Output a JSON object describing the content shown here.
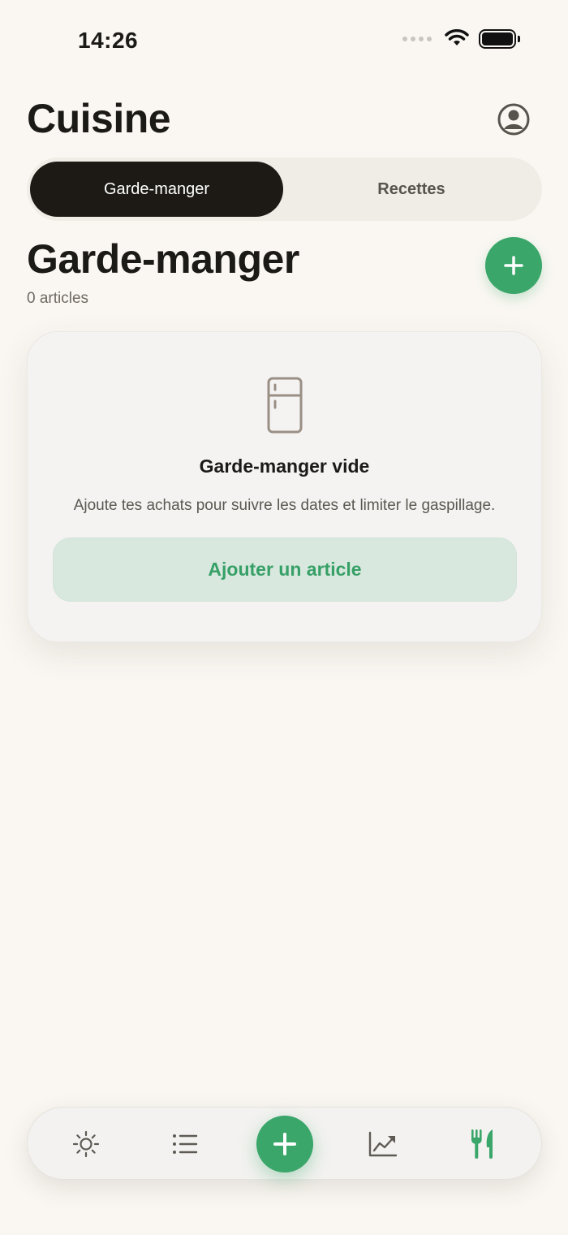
{
  "status_bar": {
    "time": "14:26"
  },
  "header": {
    "title": "Cuisine",
    "profile_icon": "person-circle-icon"
  },
  "segmented": {
    "tabs": [
      {
        "label": "Garde-manger",
        "active": true
      },
      {
        "label": "Recettes",
        "active": false
      }
    ]
  },
  "section": {
    "title": "Garde-manger",
    "count_text": "0 articles"
  },
  "empty_state": {
    "icon": "fridge-icon",
    "title": "Garde-manger vide",
    "description": "Ajoute tes achats pour suivre les dates et limiter le gaspillage.",
    "cta_label": "Ajouter un article"
  },
  "bottom_nav": {
    "items": [
      {
        "icon": "sun-icon",
        "active": false
      },
      {
        "icon": "list-icon",
        "active": false
      },
      {
        "icon": "plus-icon",
        "active": false
      },
      {
        "icon": "chart-trend-icon",
        "active": false
      },
      {
        "icon": "fork-knife-icon",
        "active": true
      }
    ]
  },
  "colors": {
    "accent": "#3aa66a",
    "background": "#faf7f2",
    "segment_active": "#1d1a16",
    "cta_background": "#d9e8df",
    "icon_muted": "#9a8f85"
  }
}
